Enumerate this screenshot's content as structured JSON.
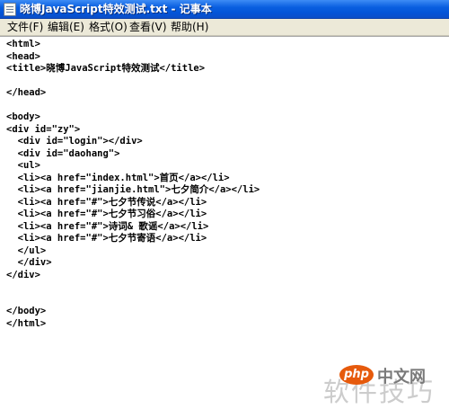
{
  "window": {
    "title": "晓博JavaScript特效测试.txt - 记事本",
    "icon": "notepad-icon"
  },
  "menu": {
    "items": [
      "文件(F)",
      "编辑(E)",
      "格式(O)",
      "查看(V)",
      "帮助(H)"
    ]
  },
  "editor": {
    "lines": [
      "<html>",
      "<head>",
      "<title>晓博JavaScript特效测试</title>",
      "",
      "</head>",
      "",
      "<body>",
      "<div id=\"zy\">",
      "  <div id=\"login\"></div>",
      "  <div id=\"daohang\">",
      "  <ul>",
      "  <li><a href=\"index.html\">首页</a></li>",
      "  <li><a href=\"jianjie.html\">七夕简介</a></li>",
      "  <li><a href=\"#\">七夕节传说</a></li>",
      "  <li><a href=\"#\">七夕节习俗</a></li>",
      "  <li><a href=\"#\">诗词& 歌谣</a></li>",
      "  <li><a href=\"#\">七夕节寄语</a></li>",
      "  </ul>",
      "  </div>",
      "</div>",
      "",
      "",
      "</body>",
      "</html>"
    ]
  },
  "watermark": {
    "text": "软件技巧",
    "logo": "php",
    "site": "中文网"
  }
}
